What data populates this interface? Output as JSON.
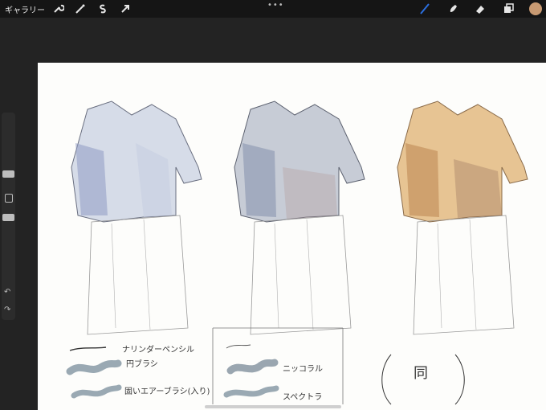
{
  "toolbar": {
    "gallery_label": "ギャラリー",
    "dots": "•••",
    "icons": [
      "wrench-icon",
      "magic-wand-icon",
      "selection-icon",
      "transform-arrow-icon",
      "brush-icon",
      "smudge-icon",
      "eraser-icon",
      "layers-icon",
      "color-swatch-icon"
    ],
    "brush_color": "#2b6fe0",
    "avatar_color": "#c89a72"
  },
  "canvas": {
    "notes_left": [
      "ナリンダーペンシル",
      "円ブラシ",
      "固いエアーブラシ(入り)"
    ],
    "notes_middle": [
      "ニッコラル",
      "スペクトラ"
    ],
    "note_right": "同"
  },
  "sidebar": {
    "undo": "↶",
    "redo": "↷"
  }
}
